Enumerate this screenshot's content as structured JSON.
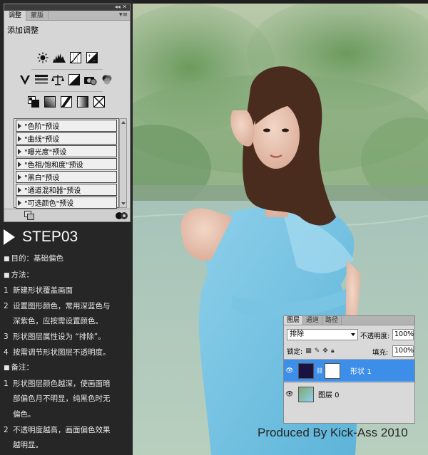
{
  "adjust_panel": {
    "tabs": [
      "调整",
      "蒙版"
    ],
    "title": "添加调整",
    "presets": [
      "\"色阶\"预设",
      "\"曲线\"预设",
      "\"曝光度\"预设",
      "\"色相/饱和度\"预设",
      "\"黑白\"预设",
      "\"通道混和器\"预设",
      "\"可选颜色\"预设"
    ]
  },
  "step": {
    "title": "STEP03",
    "lines": [
      {
        "kind": "bullet",
        "text": "目的：基础偏色"
      },
      {
        "kind": "bullet",
        "text": "方法："
      },
      {
        "kind": "numbered",
        "num": "1",
        "text": "新建形状覆盖画面"
      },
      {
        "kind": "numbered",
        "num": "2",
        "text": "设置图形颜色，常用深蓝色与"
      },
      {
        "kind": "cont",
        "text": "深紫色，应按需设置颜色。"
      },
      {
        "kind": "numbered",
        "num": "3",
        "text": "形状图层属性设为 “排除”。"
      },
      {
        "kind": "numbered",
        "num": "4",
        "text": "按需调节形状图层不透明度。"
      },
      {
        "kind": "bullet",
        "text": "备注："
      },
      {
        "kind": "numbered",
        "num": "1",
        "text": "形状图层颜色越深，使画面暗"
      },
      {
        "kind": "cont",
        "text": "部偏色月不明显，纯黑色时无"
      },
      {
        "kind": "cont",
        "text": "偏色。"
      },
      {
        "kind": "numbered",
        "num": "2",
        "text": "不透明度越高，画面偏色效果"
      },
      {
        "kind": "cont",
        "text": "越明显。"
      }
    ]
  },
  "layers_panel": {
    "tabs": [
      "图层",
      "通道",
      "路径"
    ],
    "blend_mode": "排除",
    "opacity_label": "不透明度:",
    "opacity": "100%",
    "lock_label": "锁定:",
    "fill_label": "填充:",
    "fill": "100%",
    "layers": [
      {
        "name": "形状 1",
        "selected": true
      },
      {
        "name": "图层 0",
        "selected": false
      }
    ]
  },
  "credit": "Produced By Kick-Ass 2010",
  "colors": {
    "background": "#1f1f1f",
    "panel": "#d6d6d6",
    "selection": "#3d8ee8",
    "shape_fill": "#1a1240"
  }
}
